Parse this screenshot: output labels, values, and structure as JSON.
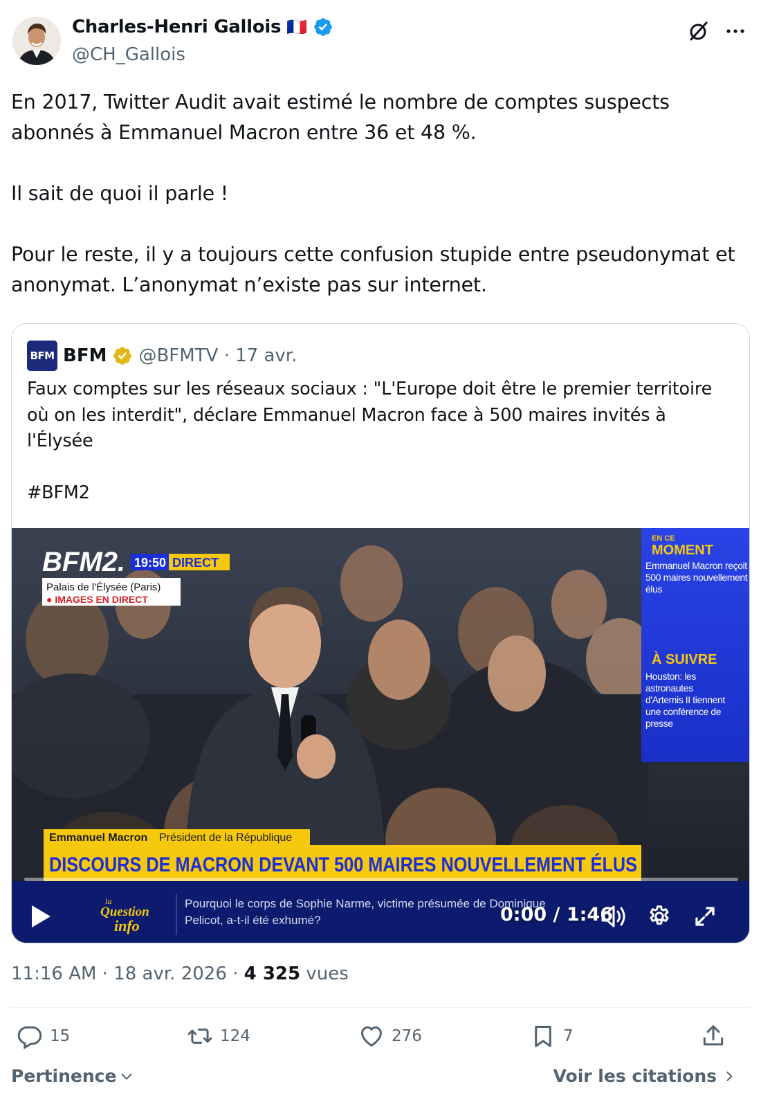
{
  "author": {
    "display_name": "Charles-Henri Gallois",
    "flag": "🇫🇷",
    "handle": "@CH_Gallois"
  },
  "tweet": {
    "text": "En 2017, Twitter Audit avait estimé le nombre de comptes suspects abonnés à Emmanuel Macron entre 36 et 48 %.\n\nIl sait de quoi il parle !\n\nPour le reste, il y a toujours cette confusion stupide entre pseudonymat et anonymat. L’anonymat n’existe pas sur internet."
  },
  "quote": {
    "logo_text": "BFM",
    "name": "BFM",
    "handle_date": "@BFMTV · 17 avr.",
    "text": "Faux comptes sur les réseaux sociaux : \"L'Europe doit être le premier territoire où on les interdit\", déclare Emmanuel Macron face à 500 maires invités à l'Élysée\n\n#BFM2"
  },
  "video": {
    "channel_logo": "BFM2.",
    "clock": "19:50",
    "live_tag": "DIRECT",
    "location": "Palais de l'Élysée (Paris)",
    "live_images": "● IMAGES EN DIRECT",
    "side_moment_small": "EN CE",
    "side_moment_title": "MOMENT",
    "side_moment_text": "Emmanuel Macron reçoit 500 maires nouvellement élus",
    "side_next_title": "À SUIVRE",
    "side_next_text": "Houston: les astronautes d'Artemis II tiennent une conférence de presse",
    "speaker_name": "Emmanuel Macron",
    "speaker_role": "Président de la République",
    "headline": "DISCOURS DE MACRON DEVANT 500 MAIRES NOUVELLEMENT ÉLUS",
    "ticker_logo_top": "la",
    "ticker_logo_main": "Question",
    "ticker_logo_sub": "info",
    "ticker_text_1": "Pourquoi le corps de Sophie Narme, victime présumée de Dominique",
    "ticker_text_2": "Pelicot, a-t-il été exhumé?",
    "time": "0:00 / 1:46",
    "progress": 0
  },
  "meta": {
    "time_date": "11:16 AM · 18 avr. 2026 · ",
    "views_count": "4 325",
    "views_label": " vues"
  },
  "actions": {
    "replies": "15",
    "reposts": "124",
    "likes": "276",
    "bookmarks": "7"
  },
  "footer": {
    "sort_label": "Pertinence",
    "quotes_link": "Voir les citations"
  },
  "colors": {
    "verified_blue": "#1d9bf0",
    "verified_gold": "#e2b719",
    "muted_text": "#536471",
    "bfm_blue": "#1e32d8",
    "bfm_yellow": "#f6c90e"
  }
}
